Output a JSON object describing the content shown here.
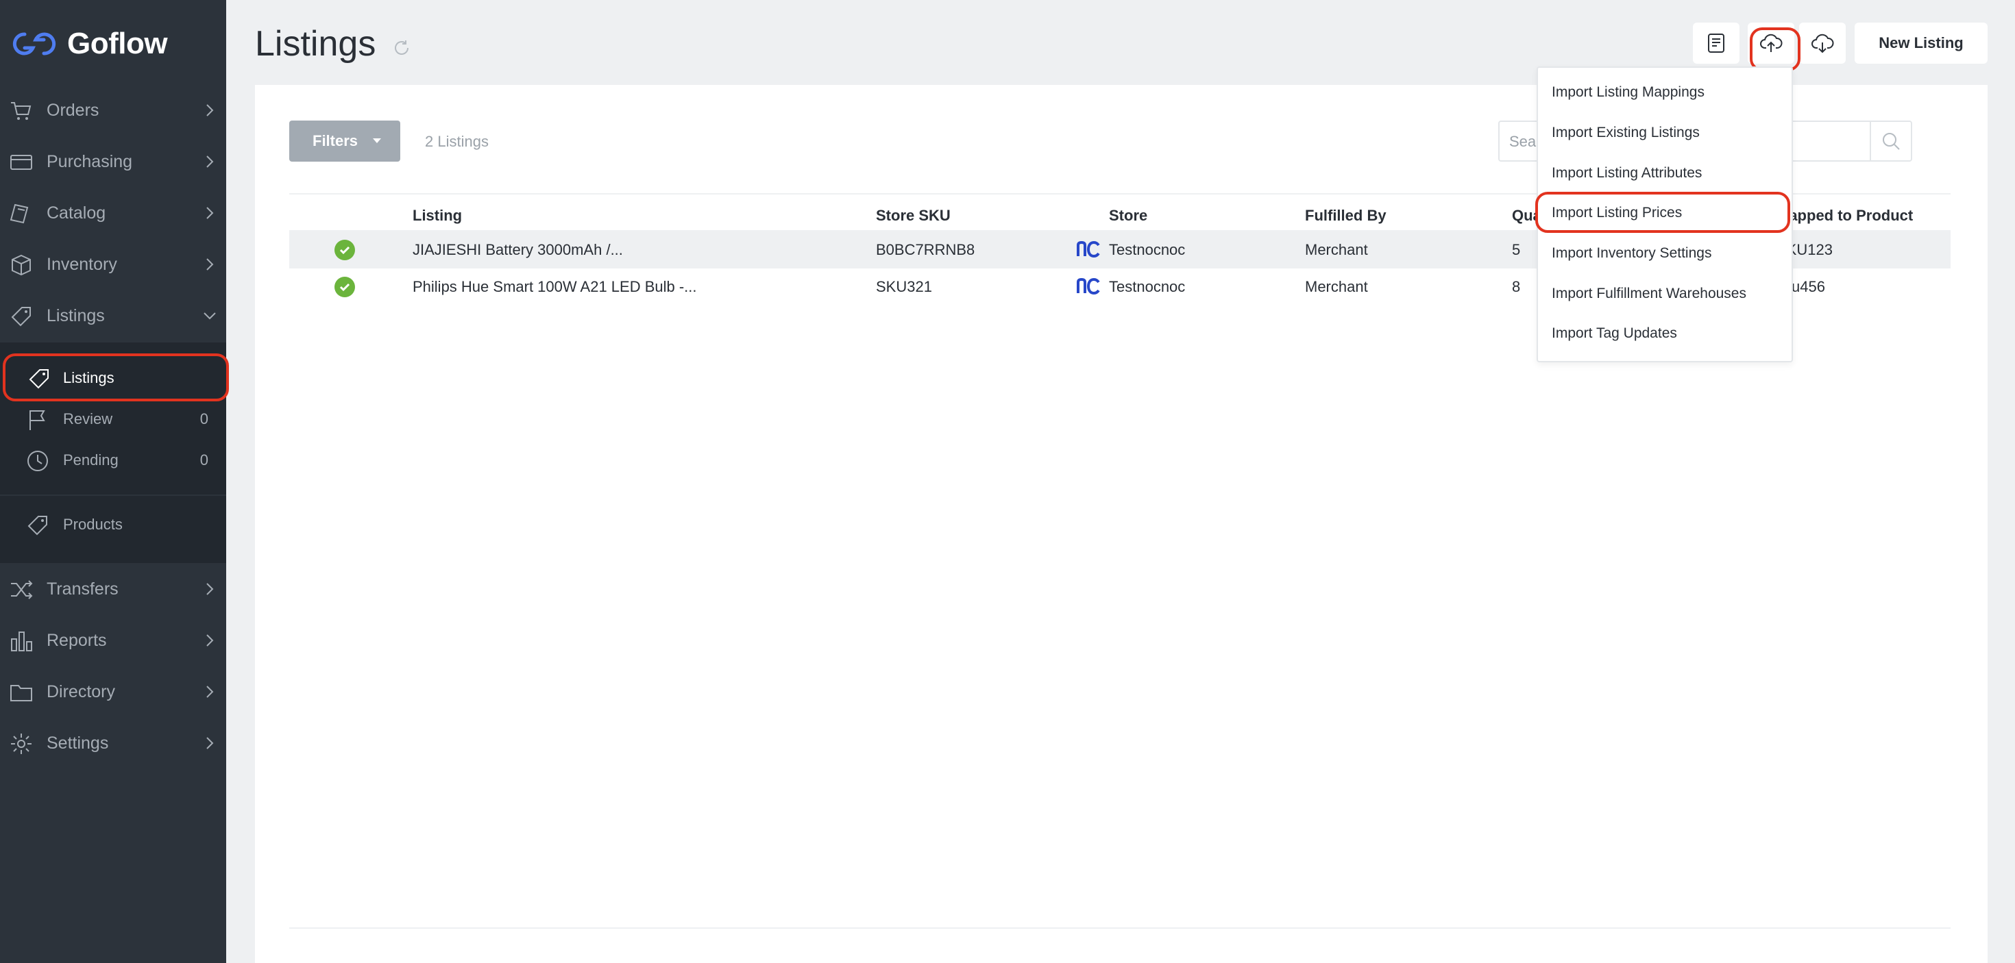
{
  "app": {
    "name": "Goflow"
  },
  "sidebar": {
    "items": [
      {
        "label": "Orders",
        "icon": "cart-icon"
      },
      {
        "label": "Purchasing",
        "icon": "card-icon"
      },
      {
        "label": "Catalog",
        "icon": "catalog-icon"
      },
      {
        "label": "Inventory",
        "icon": "box-icon"
      },
      {
        "label": "Listings",
        "icon": "tag-icon"
      },
      {
        "label": "Transfers",
        "icon": "shuffle-icon"
      },
      {
        "label": "Reports",
        "icon": "bar-chart-icon"
      },
      {
        "label": "Directory",
        "icon": "folder-icon"
      },
      {
        "label": "Settings",
        "icon": "gear-icon"
      }
    ],
    "listings_submenu": [
      {
        "label": "Listings",
        "icon": "tag-icon",
        "active": true
      },
      {
        "label": "Review",
        "count": "0",
        "icon": "flag-icon"
      },
      {
        "label": "Pending",
        "count": "0",
        "icon": "clock-icon"
      },
      {
        "label": "Products",
        "icon": "tag-icon"
      }
    ]
  },
  "header": {
    "title": "Listings",
    "new_listing_label": "New Listing"
  },
  "toolbar": {
    "filters_label": "Filters",
    "count_text": "2 Listings",
    "search_placeholder": "Search"
  },
  "table": {
    "columns": [
      "Listing",
      "Store SKU",
      "Store",
      "Fulfilled By",
      "Quantity",
      "Mapped to Product"
    ],
    "rows": [
      {
        "listing": "JIAJIESHI Battery 3000mAh /...",
        "sku": "B0BC7RRNB8",
        "store": "Testnocnoc",
        "fulfilled_by": "Merchant",
        "quantity": "5",
        "mapped": "SKU123",
        "status": "active"
      },
      {
        "listing": "Philips Hue Smart 100W A21 LED Bulb -...",
        "sku": "SKU321",
        "store": "Testnocnoc",
        "fulfilled_by": "Merchant",
        "quantity": "8",
        "mapped": "sku456",
        "status": "active"
      }
    ]
  },
  "import_menu": {
    "items": [
      "Import Listing Mappings",
      "Import Existing Listings",
      "Import Listing Attributes",
      "Import Listing Prices",
      "Import Inventory Settings",
      "Import Fulfillment Warehouses",
      "Import Tag Updates"
    ],
    "highlighted_index": 3
  },
  "colors": {
    "sidebar_bg": "#2c333b",
    "sidebar_sub_bg": "#22282f",
    "brand_blue": "#3f6be4",
    "status_green": "#6bb43c",
    "highlight_red": "#e2331f",
    "filters_gray": "#a2aab2"
  }
}
